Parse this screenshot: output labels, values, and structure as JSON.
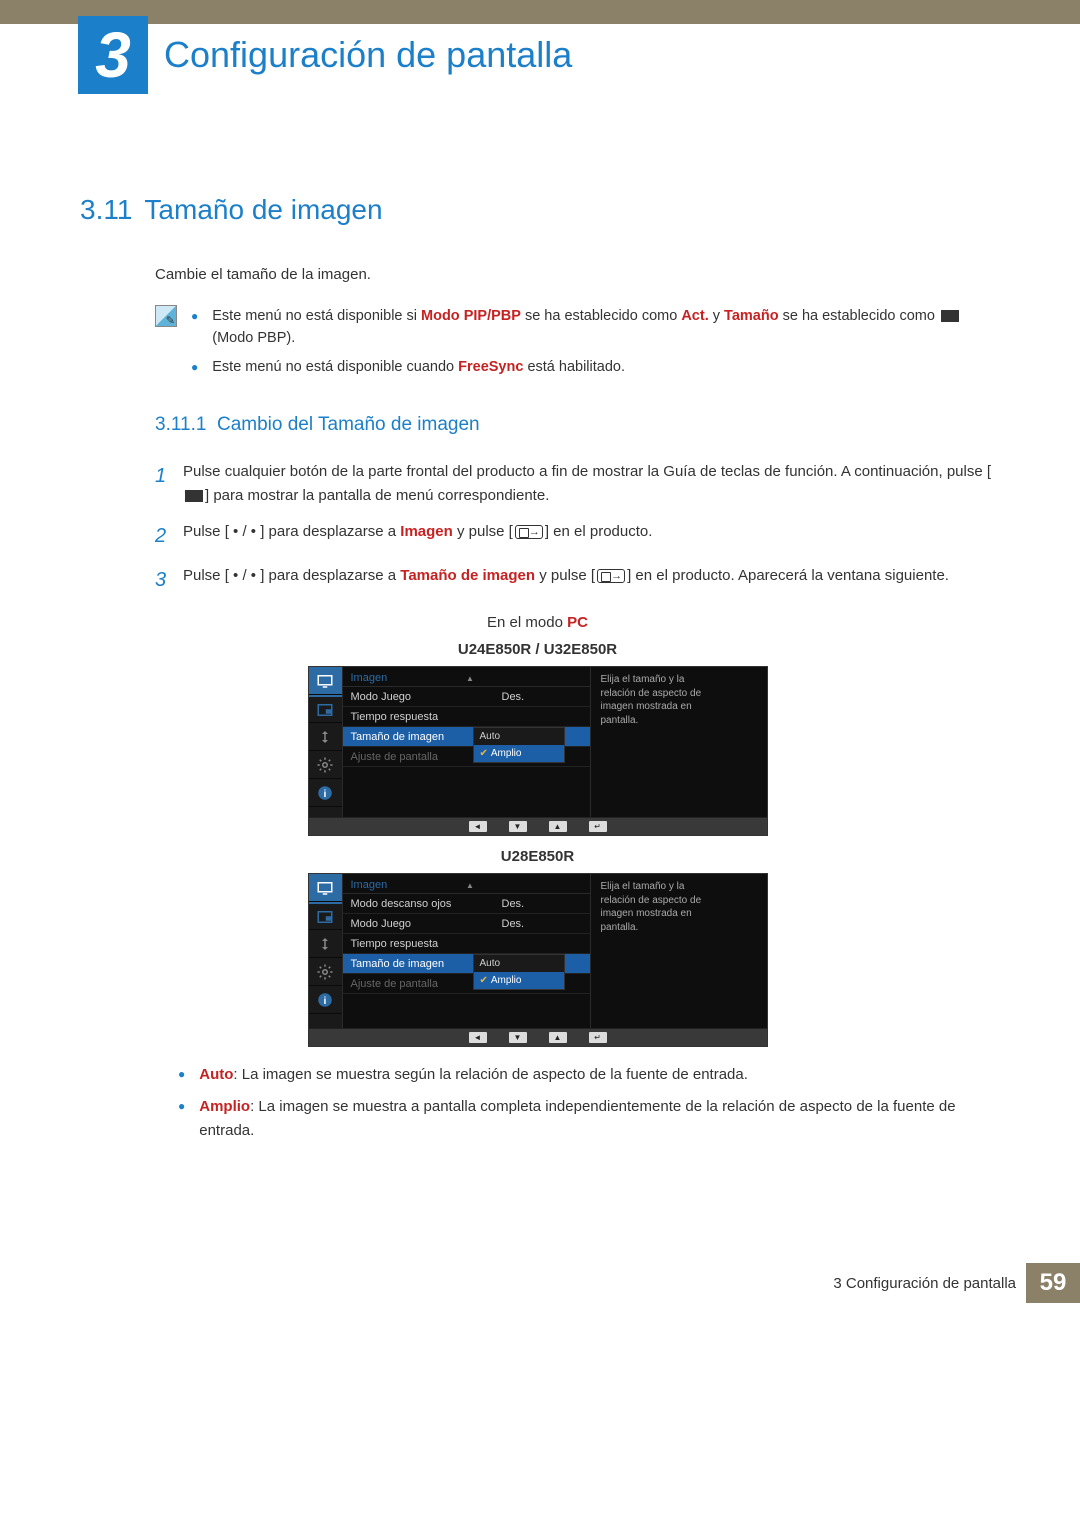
{
  "chapter": {
    "number": "3",
    "title": "Configuración de pantalla"
  },
  "section": {
    "number": "3.11",
    "title": "Tamaño de imagen"
  },
  "intro": "Cambie el tamaño de la imagen.",
  "note1": {
    "prefix": "Este menú no está disponible si ",
    "modo_pipbp": "Modo PIP/PBP",
    "mid1": " se ha establecido como ",
    "act": "Act.",
    "mid2": " y ",
    "tamano": "Tamaño",
    "mid3": " se ha establecido como ",
    "suffix": " (Modo PBP)."
  },
  "note2": {
    "prefix": "Este menú no está disponible cuando ",
    "freesync": "FreeSync",
    "suffix": " está habilitado."
  },
  "subsection": {
    "number": "3.11.1",
    "title": "Cambio del Tamaño de imagen"
  },
  "steps": {
    "s1": {
      "n": "1",
      "a": "Pulse cualquier botón de la parte frontal del producto a fin de mostrar la Guía de teclas de función. A continuación, pulse [",
      "b": "] para mostrar la pantalla de menú correspondiente."
    },
    "s2": {
      "n": "2",
      "a": "Pulse [ • / • ] para desplazarse a ",
      "imagen": "Imagen",
      "b": " y pulse [",
      "c": "] en el producto."
    },
    "s3": {
      "n": "3",
      "a": "Pulse [ • / • ] para desplazarse a ",
      "tamano": "Tamaño de imagen",
      "b": " y pulse [",
      "c": "] en el producto. Aparecerá la ventana siguiente."
    }
  },
  "mode_label_prefix": "En el modo ",
  "mode_label_pc": "PC",
  "model1": "U24E850R / U32E850R",
  "model2": "U28E850R",
  "osd": {
    "header": "Imagen",
    "desc": "Elija el tamaño y la relación de aspecto de imagen mostrada en pantalla.",
    "rows1": {
      "modo_juego": {
        "label": "Modo Juego",
        "val": "Des."
      },
      "tiempo": {
        "label": "Tiempo respuesta",
        "val": ""
      },
      "tamano": {
        "label": "Tamaño de imagen",
        "val": "Auto"
      },
      "ajuste": {
        "label": "Ajuste de pantalla",
        "val": "Amplio"
      }
    },
    "rows2": {
      "modo_descanso": {
        "label": "Modo descanso ojos",
        "val": "Des."
      },
      "modo_juego": {
        "label": "Modo Juego",
        "val": "Des."
      },
      "tiempo": {
        "label": "Tiempo respuesta",
        "val": ""
      },
      "tamano": {
        "label": "Tamaño de imagen",
        "val": "Auto"
      },
      "ajuste": {
        "label": "Ajuste de pantalla",
        "val": "Amplio"
      }
    },
    "dd": {
      "auto": "Auto",
      "amplio": "Amplio"
    },
    "nav": {
      "left": "◄",
      "down": "▼",
      "up": "▲",
      "enter": "↵"
    }
  },
  "descriptions": {
    "auto": {
      "label": "Auto",
      "text": ": La imagen se muestra según la relación de aspecto de la fuente de entrada."
    },
    "amplio": {
      "label": "Amplio",
      "text": ": La imagen se muestra a pantalla completa independientemente de la relación de aspecto de la fuente de entrada."
    }
  },
  "footer": {
    "text": "3 Configuración de pantalla",
    "page": "59"
  }
}
